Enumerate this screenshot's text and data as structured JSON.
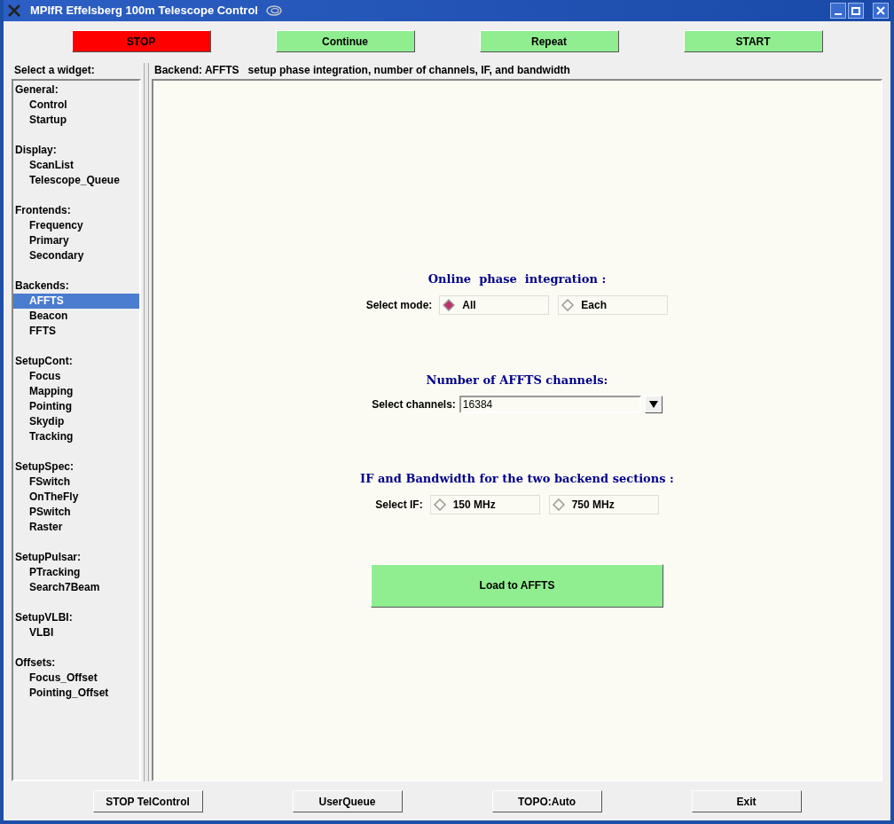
{
  "window": {
    "title": "MPIfR Effelsberg 100m Telescope Control"
  },
  "top_buttons": [
    {
      "label": "STOP",
      "color": "#ff0000"
    },
    {
      "label": "Continue",
      "color": "#90ee90"
    },
    {
      "label": "Repeat",
      "color": "#90ee90"
    },
    {
      "label": "START",
      "color": "#90ee90"
    }
  ],
  "sidebar": {
    "title": "Select a widget:",
    "groups": [
      {
        "label": "General:",
        "children": [
          {
            "label": "Control",
            "selected": false
          },
          {
            "label": "Startup",
            "selected": false
          }
        ]
      },
      {
        "label": "Display:",
        "children": [
          {
            "label": "ScanList",
            "selected": false
          },
          {
            "label": "Telescope_Queue",
            "selected": false
          }
        ]
      },
      {
        "label": "Frontends:",
        "children": [
          {
            "label": "Frequency",
            "selected": false
          },
          {
            "label": "Primary",
            "selected": false
          },
          {
            "label": "Secondary",
            "selected": false
          }
        ]
      },
      {
        "label": "Backends:",
        "children": [
          {
            "label": "AFFTS",
            "selected": true
          },
          {
            "label": "Beacon",
            "selected": false
          },
          {
            "label": "FFTS",
            "selected": false
          }
        ]
      },
      {
        "label": "SetupCont:",
        "children": [
          {
            "label": "Focus",
            "selected": false
          },
          {
            "label": "Mapping",
            "selected": false
          },
          {
            "label": "Pointing",
            "selected": false
          },
          {
            "label": "Skydip",
            "selected": false
          },
          {
            "label": "Tracking",
            "selected": false
          }
        ]
      },
      {
        "label": "SetupSpec:",
        "children": [
          {
            "label": "FSwitch",
            "selected": false
          },
          {
            "label": "OnTheFly",
            "selected": false
          },
          {
            "label": "PSwitch",
            "selected": false
          },
          {
            "label": "Raster",
            "selected": false
          }
        ]
      },
      {
        "label": "SetupPulsar:",
        "children": [
          {
            "label": "PTracking",
            "selected": false
          },
          {
            "label": "Search7Beam",
            "selected": false
          }
        ]
      },
      {
        "label": "SetupVLBI:",
        "children": [
          {
            "label": "VLBI",
            "selected": false
          }
        ]
      },
      {
        "label": "Offsets:",
        "children": [
          {
            "label": "Focus_Offset",
            "selected": false
          },
          {
            "label": "Pointing_Offset",
            "selected": false
          }
        ]
      }
    ]
  },
  "panel": {
    "header": "Backend: AFFTS   setup phase integration, number of channels, IF, and bandwidth",
    "sections": [
      {
        "kind": "radio",
        "heading": "Online  phase  integration :",
        "label": "Select mode:",
        "options": [
          {
            "label": "All",
            "selected": true
          },
          {
            "label": "Each",
            "selected": false
          }
        ]
      },
      {
        "kind": "combo",
        "heading": "Number of AFFTS channels:",
        "label": "Select channels:",
        "value": "16384"
      },
      {
        "kind": "radio",
        "heading": "IF and Bandwidth for the two backend sections :",
        "label": "Select IF:",
        "options": [
          {
            "label": "150 MHz",
            "selected": false
          },
          {
            "label": "750 MHz",
            "selected": false
          }
        ]
      }
    ],
    "action_button": "Load to AFFTS"
  },
  "bottom_buttons": [
    "STOP TelControl",
    "UserQueue",
    "TOPO:Auto",
    "Exit"
  ]
}
